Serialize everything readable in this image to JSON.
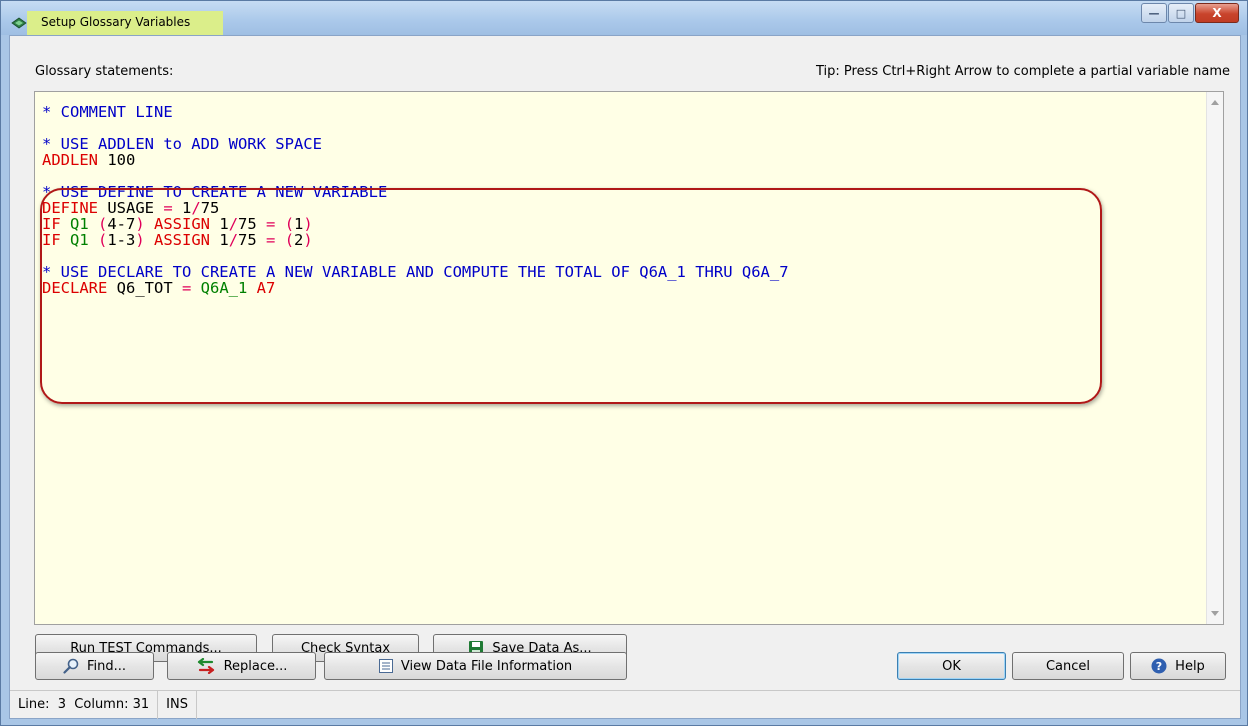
{
  "window": {
    "title": "Setup Glossary Variables",
    "controls": {
      "minimize": "—",
      "maximize": "□",
      "close": "X"
    }
  },
  "labels": {
    "glossary": "Glossary statements:",
    "tip": "Tip: Press Ctrl+Right Arrow to complete a partial variable name"
  },
  "code": {
    "lines": [
      [
        {
          "t": "* COMMENT LINE",
          "c": "blue"
        }
      ],
      [],
      [
        {
          "t": "* USE ADDLEN to ADD WORK SPACE",
          "c": "blue"
        }
      ],
      [
        {
          "t": "ADDLEN ",
          "c": "red"
        },
        {
          "t": "100",
          "c": "black"
        }
      ],
      [],
      [
        {
          "t": "* USE DEFINE TO CREATE A NEW VARIABLE",
          "c": "blue"
        }
      ],
      [
        {
          "t": "DEFINE ",
          "c": "red"
        },
        {
          "t": "USAGE ",
          "c": "black"
        },
        {
          "t": "= ",
          "c": "pink"
        },
        {
          "t": "1",
          "c": "black"
        },
        {
          "t": "/",
          "c": "pink"
        },
        {
          "t": "75",
          "c": "black"
        }
      ],
      [
        {
          "t": "IF ",
          "c": "red"
        },
        {
          "t": "Q1 ",
          "c": "green"
        },
        {
          "t": "(",
          "c": "pink"
        },
        {
          "t": "4-7",
          "c": "black"
        },
        {
          "t": ") ",
          "c": "pink"
        },
        {
          "t": "ASSIGN ",
          "c": "red"
        },
        {
          "t": "1",
          "c": "black"
        },
        {
          "t": "/",
          "c": "pink"
        },
        {
          "t": "75 ",
          "c": "black"
        },
        {
          "t": "= (",
          "c": "pink"
        },
        {
          "t": "1",
          "c": "black"
        },
        {
          "t": ")",
          "c": "pink"
        }
      ],
      [
        {
          "t": "IF ",
          "c": "red"
        },
        {
          "t": "Q1 ",
          "c": "green"
        },
        {
          "t": "(",
          "c": "pink"
        },
        {
          "t": "1-3",
          "c": "black"
        },
        {
          "t": ") ",
          "c": "pink"
        },
        {
          "t": "ASSIGN ",
          "c": "red"
        },
        {
          "t": "1",
          "c": "black"
        },
        {
          "t": "/",
          "c": "pink"
        },
        {
          "t": "75 ",
          "c": "black"
        },
        {
          "t": "= (",
          "c": "pink"
        },
        {
          "t": "2",
          "c": "black"
        },
        {
          "t": ")",
          "c": "pink"
        }
      ],
      [],
      [
        {
          "t": "* USE DECLARE TO CREATE A NEW VARIABLE AND COMPUTE THE TOTAL OF Q6A_1 THRU Q6A_7",
          "c": "blue"
        }
      ],
      [
        {
          "t": "DECLARE ",
          "c": "red"
        },
        {
          "t": "Q6_TOT ",
          "c": "black"
        },
        {
          "t": "= ",
          "c": "pink"
        },
        {
          "t": "Q6A_1 ",
          "c": "green"
        },
        {
          "t": "A7",
          "c": "red"
        }
      ]
    ]
  },
  "buttons": {
    "run_test": "Run TEST Commands...",
    "check_syntax": "Check Syntax",
    "save_data_as": "Save Data As...",
    "find": "Find...",
    "replace": "Replace...",
    "view_data_file_info": "View Data File Information",
    "ok": "OK",
    "cancel": "Cancel",
    "help": "Help"
  },
  "status": {
    "line_label": "Line:",
    "line_value": "3",
    "column_label": "Column:",
    "column_value": "31",
    "mode": "INS"
  },
  "colors": {
    "comment": "#0000c8",
    "keyword": "#dc0000",
    "variable": "#008000",
    "operator": "#e0005a",
    "highlight_box": "#b01818",
    "editor_bg": "#ffffe6"
  }
}
